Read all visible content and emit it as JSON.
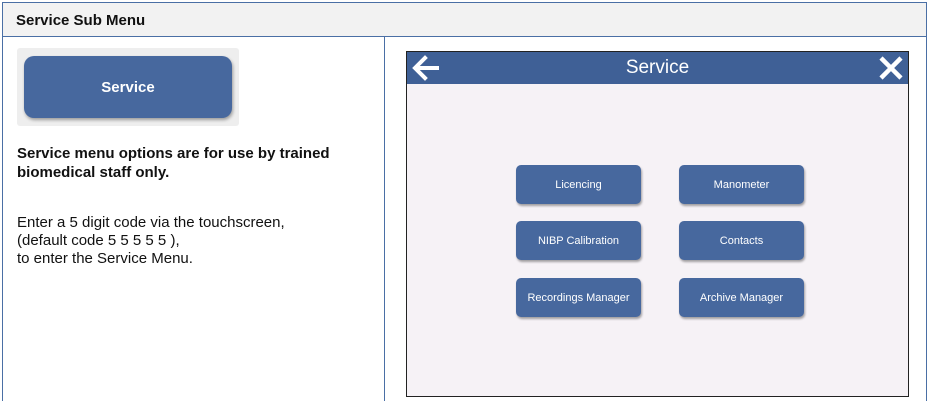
{
  "header": {
    "title": "Service Sub Menu"
  },
  "left": {
    "service_button_label": "Service",
    "warning": "Service menu options are for use by trained biomedical staff only.",
    "instructions": [
      "Enter a 5 digit code via the touchscreen,",
      "(default code 5 5 5 5 5 ),",
      "to enter the Service Menu."
    ]
  },
  "device": {
    "title": "Service",
    "buttons": [
      {
        "label": "Licencing"
      },
      {
        "label": "Manometer"
      },
      {
        "label": "NIBP Calibration"
      },
      {
        "label": "Contacts"
      },
      {
        "label": "Recordings Manager"
      },
      {
        "label": "Archive Manager"
      }
    ]
  },
  "colors": {
    "button_blue": "#47689e",
    "topbar_blue": "#3f6096",
    "screen_bg": "#f6f2f6",
    "border_blue": "#4a6fa5"
  },
  "icons": {
    "back": "arrow-left-icon",
    "close": "close-x-icon"
  }
}
